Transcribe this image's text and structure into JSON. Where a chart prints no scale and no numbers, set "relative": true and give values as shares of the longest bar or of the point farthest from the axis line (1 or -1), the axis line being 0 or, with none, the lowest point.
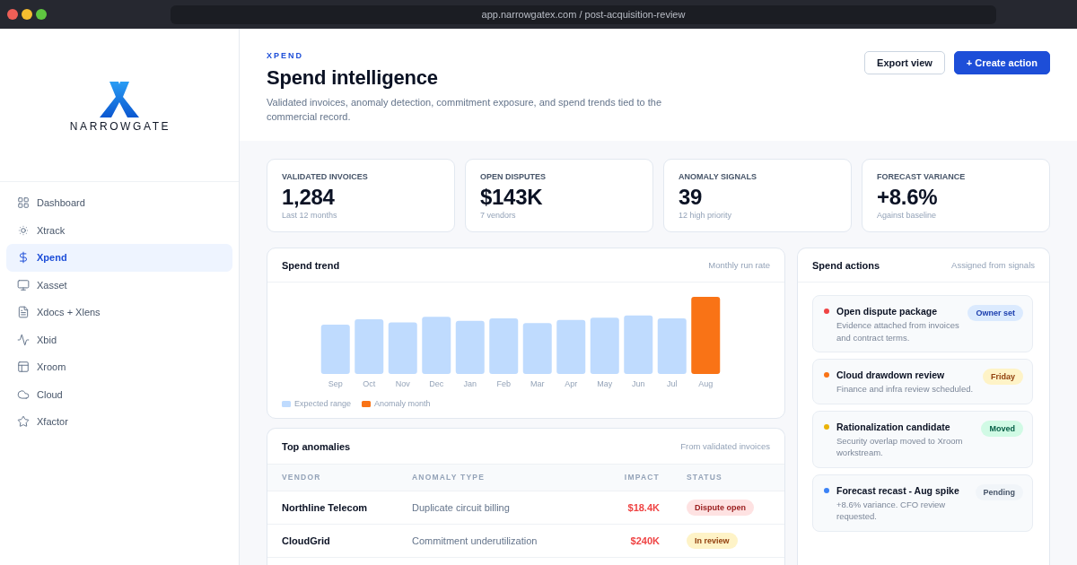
{
  "browser": {
    "url": "app.narrowgatex.com / post-acquisition-review"
  },
  "sidebar": {
    "brand": "NARROWGATE",
    "items": [
      {
        "label": "Dashboard",
        "selected": false
      },
      {
        "label": "Xtrack",
        "selected": false
      },
      {
        "label": "Xpend",
        "selected": true
      },
      {
        "label": "Xasset",
        "selected": false
      },
      {
        "label": "Xdocs + Xlens",
        "selected": false
      },
      {
        "label": "Xbid",
        "selected": false
      },
      {
        "label": "Xroom",
        "selected": false
      },
      {
        "label": "Cloud",
        "selected": false
      },
      {
        "label": "Xfactor",
        "selected": false
      }
    ]
  },
  "header": {
    "eyebrow": "XPEND",
    "title": "Spend intelligence",
    "subtitle": "Validated invoices, anomaly detection, commitment exposure, and spend trends tied to the commercial record.",
    "buttons": [
      {
        "label": "Export view",
        "kind": "secondary"
      },
      {
        "label": "+ Create action",
        "kind": "primary"
      }
    ]
  },
  "kpis": [
    {
      "label": "VALIDATED INVOICES",
      "value": "1,284",
      "note": "Last 12 months"
    },
    {
      "label": "OPEN DISPUTES",
      "value": "$143K",
      "note": "7 vendors"
    },
    {
      "label": "ANOMALY SIGNALS",
      "value": "39",
      "note": "12 high priority"
    },
    {
      "label": "FORECAST VARIANCE",
      "value": "+8.6%",
      "note": "Against baseline"
    }
  ],
  "spend_trend": {
    "title": "Spend trend",
    "caption": "Monthly run rate",
    "chart_data": {
      "type": "bar",
      "relative": true,
      "categories": [
        "Sep",
        "Oct",
        "Nov",
        "Dec",
        "Jan",
        "Feb",
        "Mar",
        "Apr",
        "May",
        "Jun",
        "Jul",
        "Aug"
      ],
      "series": [
        {
          "name": "Expected range",
          "color": "#bfdbfe",
          "values": [
            0.64,
            0.71,
            0.67,
            0.74,
            0.69,
            0.72,
            0.66,
            0.7,
            0.73,
            0.76,
            0.72,
            0
          ]
        },
        {
          "name": "Anomaly month",
          "color": "#f97316",
          "values": [
            0,
            0,
            0,
            0,
            0,
            0,
            0,
            0,
            0,
            0,
            0,
            1
          ]
        }
      ],
      "stacked": true
    }
  },
  "top_anomalies": {
    "title": "Top anomalies",
    "caption": "From validated invoices",
    "columns": [
      "VENDOR",
      "ANOMALY TYPE",
      "IMPACT",
      "STATUS"
    ],
    "rows": [
      {
        "vendor": "Northline Telecom",
        "anomaly_type": "Duplicate circuit billing",
        "impact": "$18.4K",
        "status": {
          "label": "Dispute open",
          "kind": "danger"
        }
      },
      {
        "vendor": "CloudGrid",
        "anomaly_type": "Commitment underutilization",
        "impact": "$240K",
        "status": {
          "label": "In review",
          "kind": "warning"
        }
      }
    ]
  },
  "spend_actions": {
    "title": "Spend actions",
    "caption": "Assigned from signals",
    "items": [
      {
        "title": "Open dispute package",
        "detail": "Evidence attached from invoices and contract terms.",
        "color": "#ef4444",
        "badge": {
          "label": "Owner set",
          "kind": "info"
        }
      },
      {
        "title": "Cloud drawdown review",
        "detail": "Finance and infra review scheduled.",
        "color": "#f97316",
        "badge": {
          "label": "Friday",
          "kind": "warning"
        }
      },
      {
        "title": "Rationalization candidate",
        "detail": "Security overlap moved to Xroom workstream.",
        "color": "#eab308",
        "badge": {
          "label": "Moved",
          "kind": "success"
        }
      },
      {
        "title": "Forecast recast - Aug spike",
        "detail": "+8.6% variance. CFO review requested.",
        "color": "#3b82f6",
        "badge": {
          "label": "Pending",
          "kind": "neutral"
        }
      }
    ]
  }
}
